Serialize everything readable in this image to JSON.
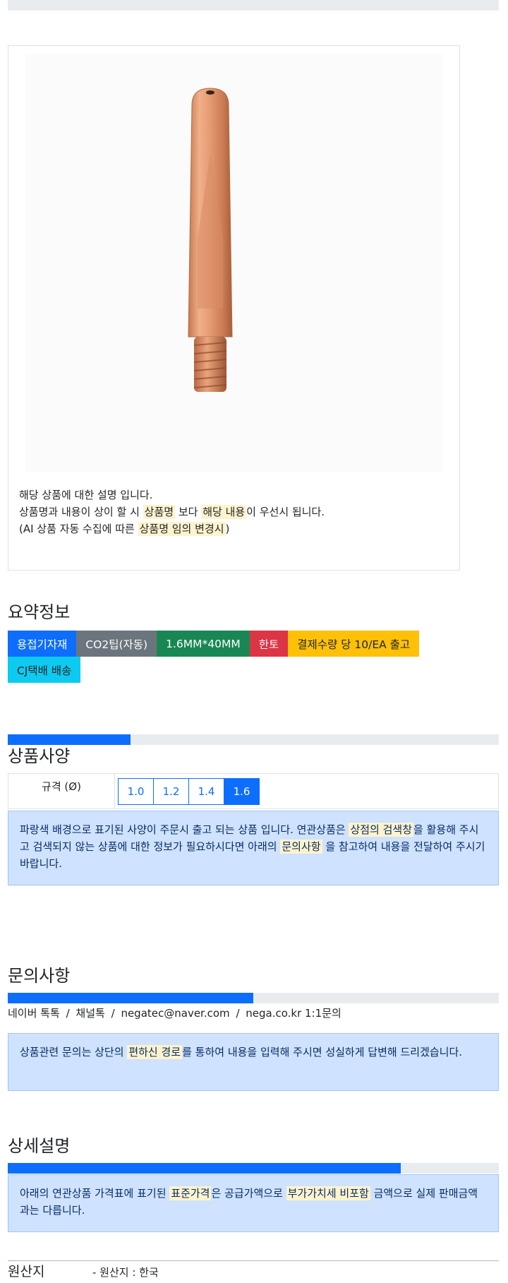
{
  "top_bar": {
    "progress": 0
  },
  "product": {
    "description_line1": "해당 상품에 대한 설명 입니다.",
    "line2_part1": "상품명과 내용이 상이 할 시 ",
    "line2_hl1": "상품명",
    "line2_part2": " 보다 ",
    "line2_hl2": "해당 내용",
    "line2_part3": "이 우선시 됩니다.",
    "line3_part1": "(AI 상품 자동 수집에 따른 ",
    "line3_hl": "상품명 임의 변경시",
    "line3_part2": ")"
  },
  "summary": {
    "title": "요약정보",
    "badges": [
      {
        "label": "용접기자재",
        "color": "#0d6efd"
      },
      {
        "label": "CO2팁(자동)",
        "color": "#6c757d"
      },
      {
        "label": "1.6MM*40MM",
        "color": "#198754"
      },
      {
        "label": "한토",
        "color": "#dc3545"
      },
      {
        "label": "결제수량 당 10/EA 출고",
        "color": "#ffc107"
      },
      {
        "label": "CJ택배 배송",
        "color": "#0dcaf0"
      }
    ]
  },
  "spec": {
    "title": "상품사양",
    "progress": 0.25,
    "row_label": "규격 (Ø)",
    "options": [
      "1.0",
      "1.2",
      "1.4",
      "1.6"
    ],
    "selected": "1.6",
    "notice_part1": "파랑색 배경으로 표기된 사양이 주문시 출고 되는 상품 입니다. 연관상품은 ",
    "notice_hl1": "상점의 검색창",
    "notice_part2": "을 활용해 주시고 검색되지 않는 상품에 대한 정보가 필요하시다면 아래의 ",
    "notice_hl2": "문의사항",
    "notice_part3": " 을 참고하여 내용을 전달하여 주시기 바랍니다."
  },
  "inquiry": {
    "title": "문의사항",
    "progress": 0.5,
    "channels": [
      "네이버 톡톡",
      "채널톡",
      "negatec@naver.com",
      "nega.co.kr 1:1문의"
    ],
    "separator": "/",
    "notice_part1": "상품관련 문의는 상단의 ",
    "notice_hl": "편하신 경로",
    "notice_part2": "를 통하여 내용을 입력해 주시면 성실하게 답변해 드리겠습니다."
  },
  "detail": {
    "title": "상세설명",
    "progress": 0.8,
    "notice_part1": "아래의 연관상품 가격표에 표기된 ",
    "notice_hl1": "표준가격",
    "notice_part2": "은 공급가액으로 ",
    "notice_hl2": "부가가치세 비포함",
    "notice_part3": " 금액으로 실제 판매금액과는 다릅니다."
  },
  "origin": {
    "label": "원산지",
    "value": "- 원산지 : 한국"
  },
  "colors": {
    "accent": "#0d6efd",
    "alert_bg": "#cfe2ff",
    "highlight": "#fff3cd"
  }
}
